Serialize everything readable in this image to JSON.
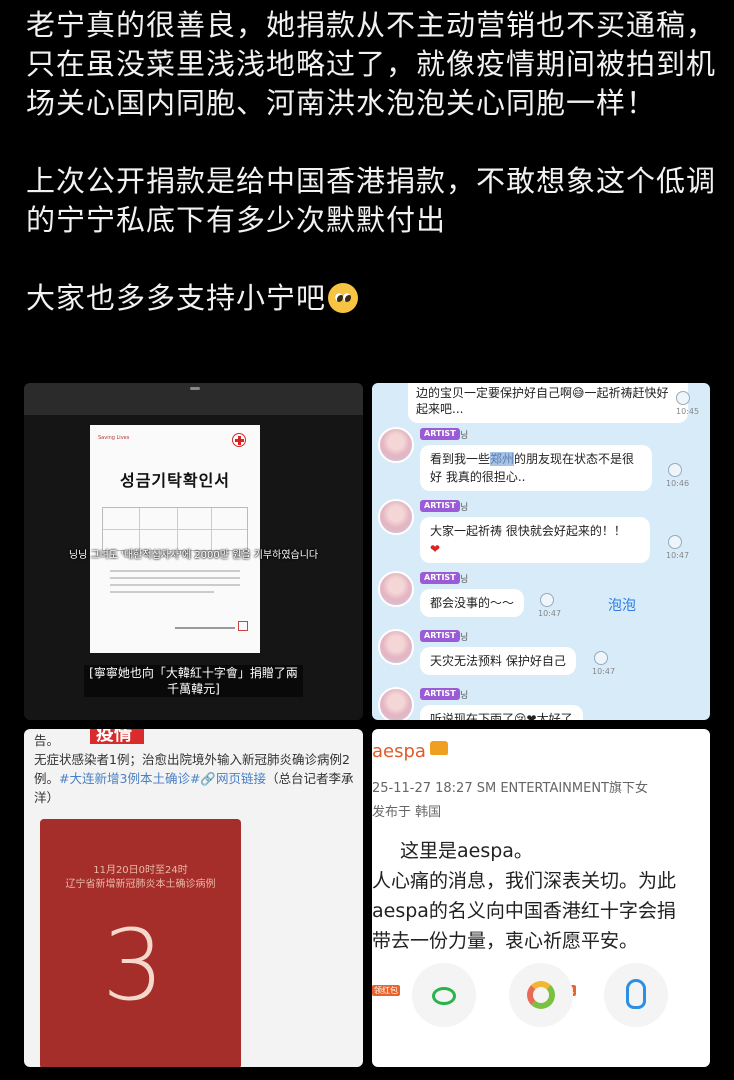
{
  "post": {
    "paragraphs": [
      "老宁真的很善良，她捐款从不主动营销也不买通稿，只在虽没菜里浅浅地略过了，就像疫情期间被拍到机场关心国内同胞、河南洪水泡泡关心同胞一样！",
      "上次公开捐款是给中国香港捐款，不敢想象这个低调的宁宁私底下有多少次默默付出",
      "大家也多多支持小宁吧"
    ],
    "emoji": "pleading-face-icon"
  },
  "panel1": {
    "cert_header": "Saving Lives",
    "cert_title": "성금기탁확인서",
    "caption_ko": "닝닝 그녀도 '대한적십자사'에 2000만 원을 기부하였습니다",
    "caption_zh": "[寧寧她也向「大韓紅十字會」捐贈了兩千萬韓元]"
  },
  "panel2": {
    "top_text": "边的宝贝一定要保护好自己啊😅一起祈祷赶快好起来吧...",
    "top_time": "10:45",
    "badge": "ARTIST",
    "nick": "닝",
    "messages": [
      {
        "pre": "看到我一些",
        "hl": "郑州",
        "post": "的朋友现在状态不是很好 我真的很担心..",
        "time": "10:46"
      },
      {
        "text": "大家一起祈祷 很快就会好起来的！！",
        "heart": "❤",
        "time": "10:47"
      },
      {
        "text": "都会没事的～～",
        "time": "10:47"
      },
      {
        "text": "天灾无法预料 保护好自己",
        "time": "10:47"
      },
      {
        "text": "听说现在下雨了😢❤太好了"
      }
    ],
    "watermark": "泡泡"
  },
  "panel3": {
    "text_1": "告。",
    "text_2": "无症状感染者1例；治愈出院境外输入新冠肺炎确诊病例2例。",
    "tag": "#大连新增3例本土确诊#",
    "link": "🔗网页链接",
    "source": "（总台记者李承洋）",
    "poster_line1": "11月20日0时至24时",
    "poster_line2": "辽宁省新增新冠肺炎本土确诊病例",
    "poster_number": "3"
  },
  "panel4": {
    "name": "aespa",
    "meta": "25-11-27 18:27  SM ENTERTAINMENT旗下女",
    "from": "发布于 韩国",
    "body_1": "这里是aespa。",
    "body_2": "人心痛的消息，我们深表关切。为此",
    "body_3": "aespa的名义向中国香港红十字会捐",
    "body_4": "带去一份力量，衷心祈愿平安。",
    "share_tag": "领红包"
  }
}
